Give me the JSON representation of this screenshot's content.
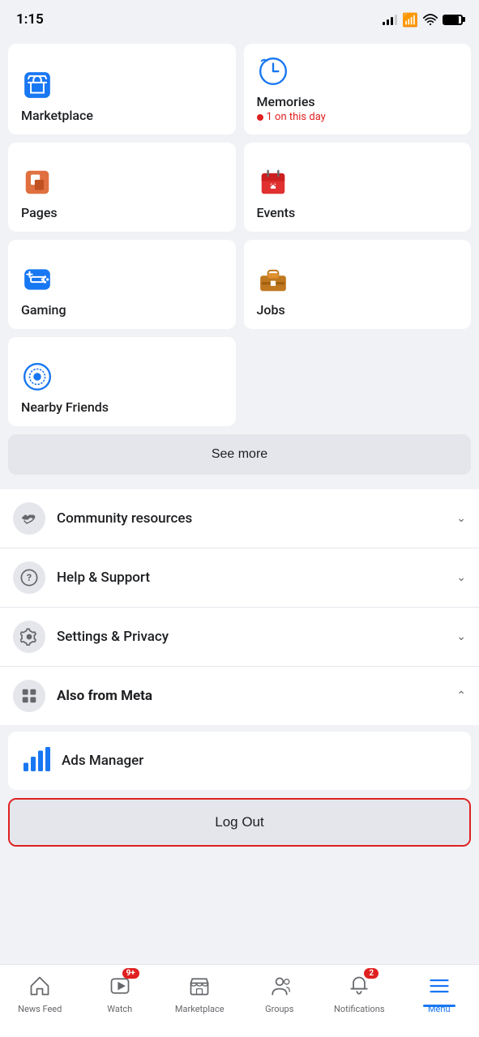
{
  "statusBar": {
    "time": "1:15",
    "batteryFull": true
  },
  "menuItems": {
    "marketplace": {
      "label": "Marketplace",
      "icon": "marketplace-icon"
    },
    "memories": {
      "label": "Memories",
      "sub": "1 on this day",
      "icon": "memories-icon"
    },
    "pages": {
      "label": "Pages",
      "icon": "pages-icon"
    },
    "events": {
      "label": "Events",
      "icon": "events-icon"
    },
    "gaming": {
      "label": "Gaming",
      "icon": "gaming-icon"
    },
    "jobs": {
      "label": "Jobs",
      "icon": "jobs-icon"
    },
    "nearbyFriends": {
      "label": "Nearby Friends",
      "icon": "nearby-icon"
    }
  },
  "seeMore": {
    "label": "See more"
  },
  "listItems": [
    {
      "id": "community-resources",
      "label": "Community resources",
      "icon": "handshake-icon",
      "expandable": true,
      "bold": false
    },
    {
      "id": "help-support",
      "label": "Help & Support",
      "icon": "question-icon",
      "expandable": true,
      "bold": false
    },
    {
      "id": "settings-privacy",
      "label": "Settings & Privacy",
      "icon": "gear-icon",
      "expandable": true,
      "bold": false
    },
    {
      "id": "also-from-meta",
      "label": "Also from Meta",
      "icon": "grid-icon",
      "expandable": true,
      "expanded": true,
      "bold": true
    }
  ],
  "adsManager": {
    "label": "Ads Manager",
    "icon": "ads-icon"
  },
  "logOut": {
    "label": "Log Out"
  },
  "tabBar": {
    "items": [
      {
        "id": "news-feed",
        "label": "News Feed",
        "icon": "home-icon",
        "active": false,
        "badge": null
      },
      {
        "id": "watch",
        "label": "Watch",
        "icon": "watch-icon",
        "active": false,
        "badge": "9+"
      },
      {
        "id": "marketplace",
        "label": "Marketplace",
        "icon": "marketplace-tab-icon",
        "active": false,
        "badge": null
      },
      {
        "id": "groups",
        "label": "Groups",
        "icon": "groups-icon",
        "active": false,
        "badge": null
      },
      {
        "id": "notifications",
        "label": "Notifications",
        "icon": "bell-icon",
        "active": false,
        "badge": "2"
      },
      {
        "id": "menu",
        "label": "Menu",
        "icon": "menu-icon",
        "active": true,
        "badge": null
      }
    ]
  }
}
